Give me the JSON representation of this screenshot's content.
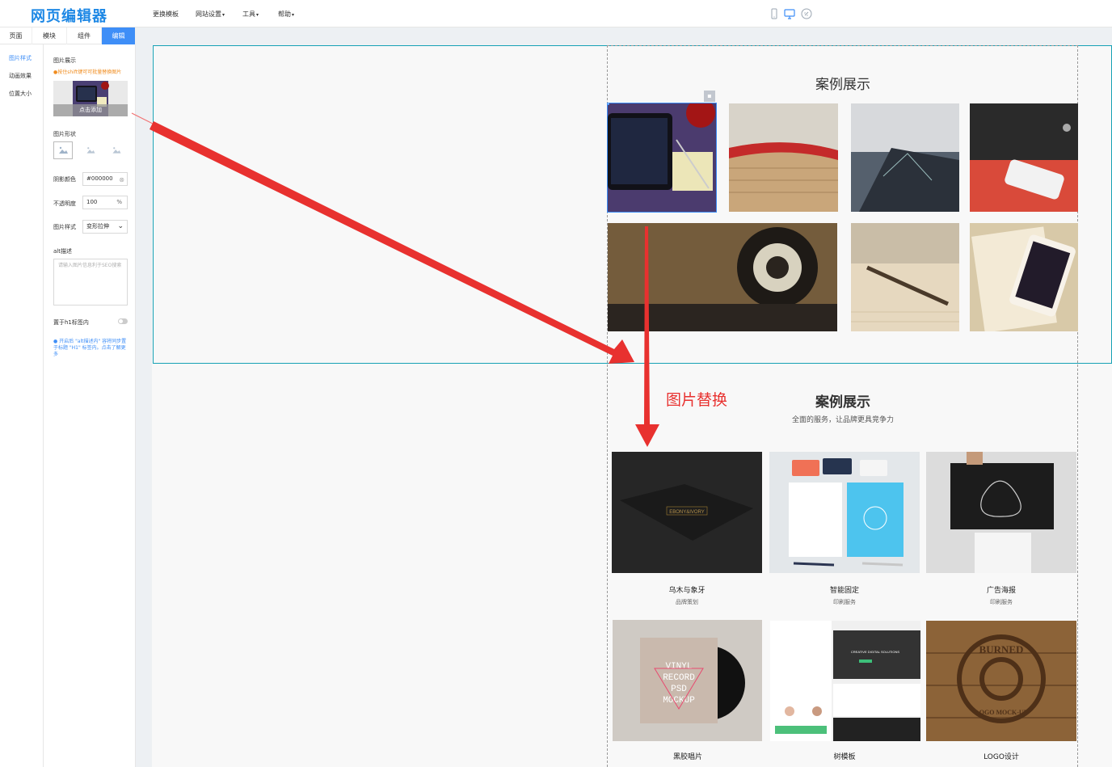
{
  "app": {
    "logo": "网页编辑器"
  },
  "topbar": {
    "menu": [
      {
        "label": "更换模板",
        "dropdown": false
      },
      {
        "label": "网站设置",
        "dropdown": true
      },
      {
        "label": "工具",
        "dropdown": true
      },
      {
        "label": "帮助",
        "dropdown": true
      }
    ],
    "caret": "▾",
    "device_icons": [
      "mobile-icon",
      "desktop-icon",
      "link-icon"
    ],
    "active_device": "desktop-icon"
  },
  "sidebar": {
    "tabs": [
      "页面",
      "模块",
      "组件",
      "编辑"
    ],
    "active_tab": "编辑",
    "nav": [
      "图片样式",
      "动画效果",
      "位置大小"
    ],
    "active_nav": "图片样式"
  },
  "panel": {
    "image_display_label": "图片展示",
    "hint": "按住shift键可可批量替换图片",
    "add_button": "点击添加",
    "shape_label": "图片形状",
    "shadow_label": "阴影颜色",
    "shadow_value": "#000000",
    "opacity_label": "不透明度",
    "opacity_value": "100",
    "opacity_unit": "%",
    "style_label": "图片样式",
    "style_value": "变形拉伸",
    "alt_label": "alt描述",
    "alt_placeholder": "请输入图片信息利于SEO搜索",
    "h1_label": "置于h1标签内",
    "info": "开启后 \"alt描述内\" 容将同步置于标题 \"H1\" 标签内。点击了解更多"
  },
  "canvas": {
    "section1_title": "案例展示",
    "replace_annotation": "图片替换",
    "section2_title": "案例展示",
    "section2_subtitle": "全面的服务，让品牌更具竞争力",
    "ebony_text": "EBONY&IVORY",
    "vinyl_text": [
      "VINYL",
      "RECORD",
      "PSD",
      "MOCKUP"
    ],
    "web_banner": "CREATIVE DIGITAL SOLUTIONS",
    "burned_text": "BURNED",
    "logo_mockup_text": "LOGO MOCK-UP",
    "cards": [
      {
        "title": "乌木与象牙",
        "sub": "品牌策划"
      },
      {
        "title": "智能固定",
        "sub": "印刷服务"
      },
      {
        "title": "广告海报",
        "sub": "印刷服务"
      },
      {
        "title": "黑胶唱片",
        "sub": ""
      },
      {
        "title": "树模板",
        "sub": ""
      },
      {
        "title": "LOGO设计",
        "sub": ""
      }
    ]
  },
  "colors": {
    "accent": "#3e8ef7",
    "annotation": "#e8312f",
    "selection": "#16a1b5"
  }
}
